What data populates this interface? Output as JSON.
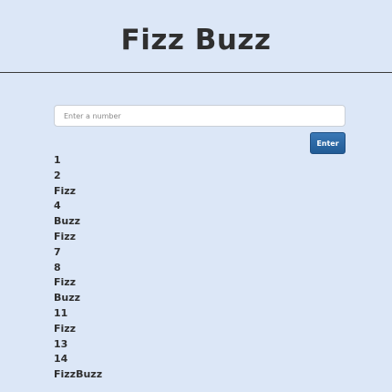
{
  "header": {
    "title": "Fizz Buzz"
  },
  "form": {
    "input_value": "",
    "input_placeholder": "Enter a number",
    "enter_label": "Enter"
  },
  "results": [
    "1",
    "2",
    "Fizz",
    "4",
    "Buzz",
    "Fizz",
    "7",
    "8",
    "Fizz",
    "Buzz",
    "11",
    "Fizz",
    "13",
    "14",
    "FizzBuzz"
  ],
  "colors": {
    "background": "#dce7f7",
    "text": "#2f2f2f",
    "button": "#2a639f",
    "input_bg": "#ffffff"
  }
}
